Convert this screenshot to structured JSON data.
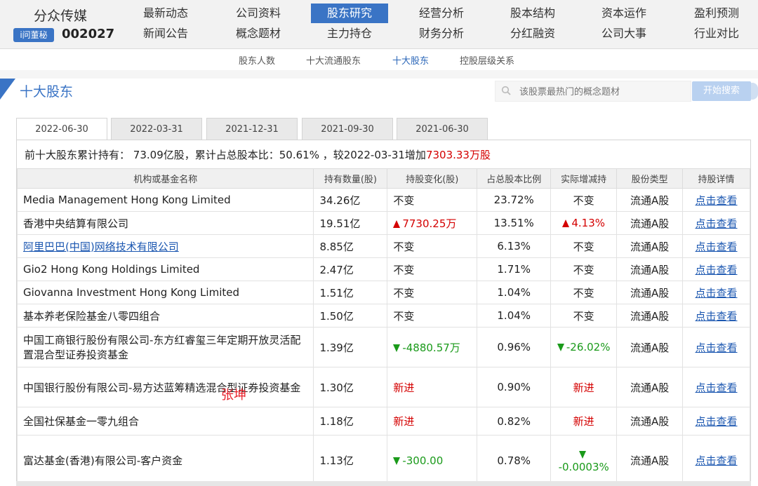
{
  "header": {
    "company": "分众传媒",
    "badge": "i问董秘",
    "stock_code": "002027",
    "nav_row1": [
      "最新动态",
      "公司资料",
      "股东研究",
      "经营分析",
      "股本结构",
      "资本运作",
      "盈利预测"
    ],
    "nav_row2": [
      "新闻公告",
      "概念题材",
      "主力持仓",
      "财务分析",
      "分红融资",
      "公司大事",
      "行业对比"
    ],
    "active_nav": "股东研究"
  },
  "subnav": {
    "items": [
      "股东人数",
      "十大流通股东",
      "十大股东",
      "控股层级关系"
    ],
    "active": "十大股东"
  },
  "section": {
    "title": "十大股东",
    "search_placeholder": "该股票最热门的概念题材",
    "search_button": "开始搜索"
  },
  "tabs": [
    "2022-06-30",
    "2022-03-31",
    "2021-12-31",
    "2021-09-30",
    "2021-06-30"
  ],
  "active_tab": "2022-06-30",
  "summary": {
    "prefix": "前十大股东累计持有：",
    "total": "73.09亿股",
    "ratio_text": "，累计占总股本比：",
    "ratio": "50.61%",
    "compare": "，较2022-03-31增加",
    "change": "7303.33万股"
  },
  "table": {
    "headers": [
      "机构或基金名称",
      "持有数量(股)",
      "持股变化(股)",
      "占总股本比例",
      "实际增减持",
      "股份类型",
      "持股详情"
    ],
    "rows": [
      {
        "name": "Media Management Hong Kong Limited",
        "qty": "34.26亿",
        "change": "不变",
        "change_dir": "none",
        "ratio": "23.72%",
        "actual": "不变",
        "actual_dir": "none",
        "type": "流通A股",
        "detail": "点击查看",
        "link": false
      },
      {
        "name": "香港中央结算有限公司",
        "qty": "19.51亿",
        "change": "7730.25万",
        "change_dir": "up",
        "ratio": "13.51%",
        "actual": "4.13%",
        "actual_dir": "up",
        "type": "流通A股",
        "detail": "点击查看",
        "link": false
      },
      {
        "name": "阿里巴巴(中国)网络技术有限公司",
        "qty": "8.85亿",
        "change": "不变",
        "change_dir": "none",
        "ratio": "6.13%",
        "actual": "不变",
        "actual_dir": "none",
        "type": "流通A股",
        "detail": "点击查看",
        "link": true
      },
      {
        "name": "Gio2 Hong Kong Holdings Limited",
        "qty": "2.47亿",
        "change": "不变",
        "change_dir": "none",
        "ratio": "1.71%",
        "actual": "不变",
        "actual_dir": "none",
        "type": "流通A股",
        "detail": "点击查看",
        "link": false
      },
      {
        "name": "Giovanna Investment Hong Kong Limited",
        "qty": "1.51亿",
        "change": "不变",
        "change_dir": "none",
        "ratio": "1.04%",
        "actual": "不变",
        "actual_dir": "none",
        "type": "流通A股",
        "detail": "点击查看",
        "link": false
      },
      {
        "name": "基本养老保险基金八零四组合",
        "qty": "1.50亿",
        "change": "不变",
        "change_dir": "none",
        "ratio": "1.04%",
        "actual": "不变",
        "actual_dir": "none",
        "type": "流通A股",
        "detail": "点击查看",
        "link": false
      },
      {
        "name": "中国工商银行股份有限公司-东方红睿玺三年定期开放灵活配置混合型证券投资基金",
        "qty": "1.39亿",
        "change": "-4880.57万",
        "change_dir": "down",
        "ratio": "0.96%",
        "actual": "-26.02%",
        "actual_dir": "down",
        "type": "流通A股",
        "detail": "点击查看",
        "link": false
      },
      {
        "name": "中国银行股份有限公司-易方达蓝筹精选混合型证券投资基金",
        "qty": "1.30亿",
        "change": "新进",
        "change_dir": "new",
        "ratio": "0.90%",
        "actual": "新进",
        "actual_dir": "new",
        "type": "流通A股",
        "detail": "点击查看",
        "link": false
      },
      {
        "name": "全国社保基金一零九组合",
        "qty": "1.18亿",
        "change": "新进",
        "change_dir": "new",
        "ratio": "0.82%",
        "actual": "新进",
        "actual_dir": "new",
        "type": "流通A股",
        "detail": "点击查看",
        "link": false
      },
      {
        "name": "富达基金(香港)有限公司-客户资金",
        "qty": "1.13亿",
        "change": "-300.00",
        "change_dir": "down",
        "ratio": "0.78%",
        "actual": "-0.0003%",
        "actual_dir": "down",
        "type": "流通A股",
        "detail": "点击查看",
        "link": false
      }
    ]
  },
  "signature": "张坤",
  "colors": {
    "accent": "#3a74c5",
    "up": "#d40000",
    "down": "#1a9a1a",
    "link": "#1a56b0"
  }
}
